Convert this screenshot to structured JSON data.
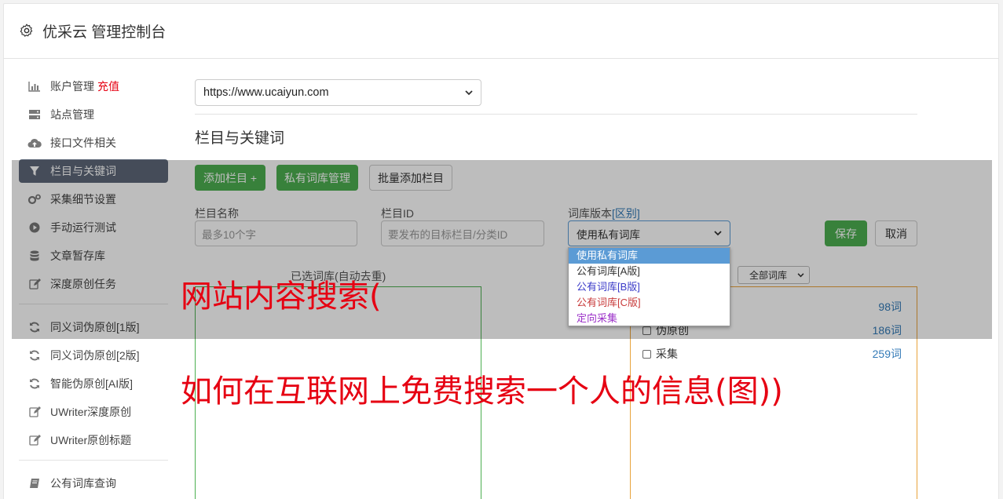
{
  "app": {
    "title": "优采云 管理控制台",
    "icon": "gear-icon"
  },
  "sidebar": {
    "group1": [
      {
        "label": "账户管理",
        "extra": "充值",
        "icon": "bar-chart-icon"
      },
      {
        "label": "站点管理",
        "icon": "server-icon"
      },
      {
        "label": "接口文件相关",
        "icon": "cloud-upload-icon"
      },
      {
        "label": "栏目与关键词",
        "icon": "filter-icon",
        "active": true
      },
      {
        "label": "采集细节设置",
        "icon": "gears-icon"
      },
      {
        "label": "手动运行测试",
        "icon": "play-icon"
      },
      {
        "label": "文章暂存库",
        "icon": "database-icon"
      },
      {
        "label": "深度原创任务",
        "icon": "edit-icon"
      }
    ],
    "group2": [
      {
        "label": "同义词伪原创[1版]",
        "icon": "refresh-icon"
      },
      {
        "label": "同义词伪原创[2版]",
        "icon": "refresh-icon"
      },
      {
        "label": "智能伪原创[AI版]",
        "icon": "refresh-icon"
      },
      {
        "label": "UWriter深度原创",
        "icon": "edit-icon"
      },
      {
        "label": "UWriter原创标题",
        "icon": "edit-icon"
      }
    ],
    "group3": [
      {
        "label": "公有词库查询",
        "icon": "book-icon"
      }
    ]
  },
  "main": {
    "site_select_value": "https://www.ucaiyun.com",
    "section_title": "栏目与关键词",
    "buttons": {
      "add_column": "添加栏目 +",
      "private_lib": "私有词库管理",
      "batch_add": "批量添加栏目",
      "save": "保存",
      "cancel": "取消"
    },
    "form": {
      "name_label": "栏目名称",
      "name_placeholder": "最多10个字",
      "id_label": "栏目ID",
      "id_placeholder": "要发布的目标栏目/分类ID",
      "version_label": "词库版本",
      "version_link": "[区别]",
      "version_value": "使用私有词库"
    },
    "dropdown": {
      "options": [
        {
          "label": "使用私有词库",
          "color": "#ffffff",
          "selected": true
        },
        {
          "label": "公有词库[A版]",
          "color": "#333333"
        },
        {
          "label": "公有词库[B版]",
          "color": "#3a3ac8"
        },
        {
          "label": "公有词库[C版]",
          "color": "#c83a3a"
        },
        {
          "label": "定向采集",
          "color": "#9b30c8"
        }
      ]
    },
    "selected_lib_label": "已选词库(自动去重)",
    "all_libs_value": "全部词库",
    "libraries": [
      {
        "name": "",
        "count": "98词"
      },
      {
        "name": "伪原创",
        "count": "186词"
      },
      {
        "name": "采集",
        "count": "259词"
      }
    ]
  },
  "overlay_text": {
    "line1": "网站内容搜索(",
    "line2": "如何在互联网上免费搜索一个人的信息(图))"
  }
}
